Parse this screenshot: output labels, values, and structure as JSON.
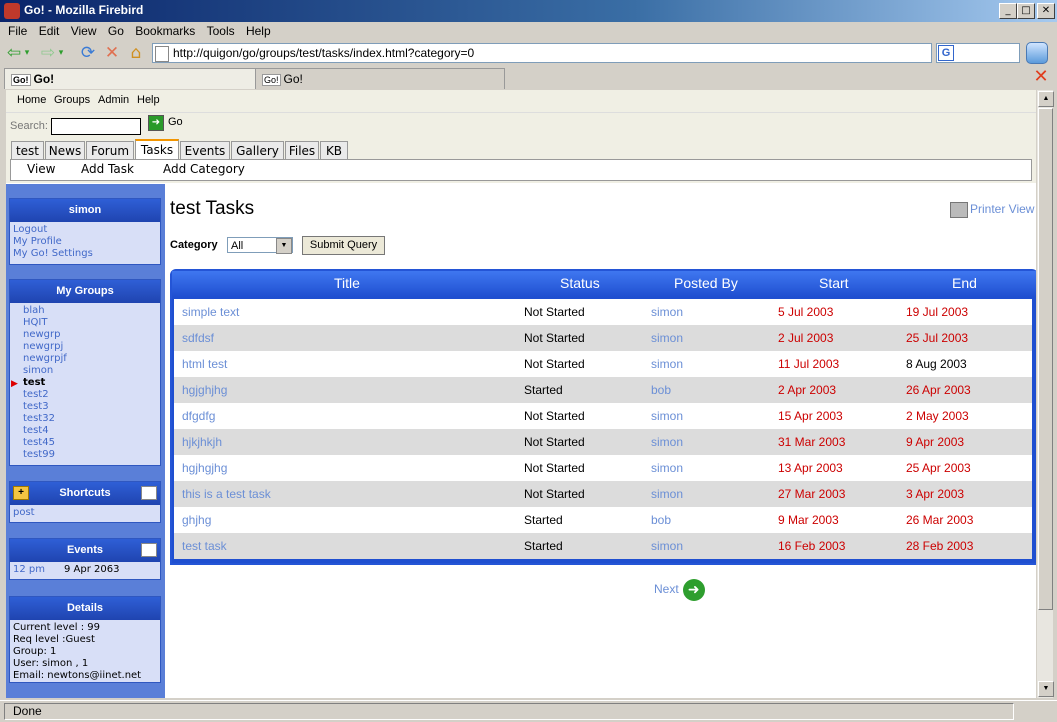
{
  "window": {
    "title": "Go! - Mozilla Firebird"
  },
  "menubar": [
    "File",
    "Edit",
    "View",
    "Go",
    "Bookmarks",
    "Tools",
    "Help"
  ],
  "address": {
    "url": "http://quigon/go/groups/test/tasks/index.html?category=0"
  },
  "browser_tabs": [
    {
      "label": "Go!",
      "icon": "Go!"
    },
    {
      "label": "Go!",
      "icon": "Go!"
    }
  ],
  "site_menu": [
    "Home",
    "Groups",
    "Admin",
    "Help"
  ],
  "search": {
    "label": "Search:",
    "go_label": "Go"
  },
  "site_tabs": [
    "test",
    "News",
    "Forum",
    "Tasks",
    "Events",
    "Gallery",
    "Files",
    "KB"
  ],
  "active_tab": "Tasks",
  "subnav": [
    "View",
    "Add Task",
    "Add Category"
  ],
  "user_box": {
    "title": "simon",
    "links": [
      "Logout",
      "My Profile",
      "My Go! Settings"
    ]
  },
  "groups_box": {
    "title": "My Groups",
    "current": "test",
    "items": [
      "blah",
      "HQIT",
      "newgrp",
      "newgrpj",
      "newgrpjf",
      "simon",
      "test",
      "test2",
      "test3",
      "test32",
      "test4",
      "test45",
      "test99"
    ]
  },
  "shortcuts_box": {
    "title": "Shortcuts",
    "items": [
      "post"
    ]
  },
  "events_box": {
    "title": "Events",
    "time": "12 pm",
    "date": "9 Apr 2063"
  },
  "details_box": {
    "title": "Details",
    "lines": [
      "Current level : 99",
      "Req level :Guest",
      "Group: 1",
      "User: simon , 1",
      "Email: newtons@iinet.net"
    ]
  },
  "page": {
    "title": "test Tasks",
    "printer_view": "Printer View",
    "category_label": "Category",
    "category_value": "All",
    "submit_label": "Submit Query",
    "next_label": "Next"
  },
  "table": {
    "headers": [
      "Title",
      "Status",
      "Posted By",
      "Start",
      "End"
    ],
    "rows": [
      {
        "title": "simple text",
        "status": "Not Started",
        "posted_by": "simon",
        "start": "5 Jul 2003",
        "end": "19 Jul 2003",
        "end_overdue": true
      },
      {
        "title": "sdfdsf",
        "status": "Not Started",
        "posted_by": "simon",
        "start": "2 Jul 2003",
        "end": "25 Jul 2003",
        "end_overdue": true
      },
      {
        "title": "html test",
        "status": "Not Started",
        "posted_by": "simon",
        "start": "11 Jul 2003",
        "end": "8 Aug 2003",
        "end_overdue": false
      },
      {
        "title": "hgjghjhg",
        "status": "Started",
        "posted_by": "bob",
        "start": "2 Apr 2003",
        "end": "26 Apr 2003",
        "end_overdue": true
      },
      {
        "title": "dfgdfg",
        "status": "Not Started",
        "posted_by": "simon",
        "start": "15 Apr 2003",
        "end": "2 May 2003",
        "end_overdue": true
      },
      {
        "title": "hjkjhkjh",
        "status": "Not Started",
        "posted_by": "simon",
        "start": "31 Mar 2003",
        "end": "9 Apr 2003",
        "end_overdue": true
      },
      {
        "title": "hgjhgjhg",
        "status": "Not Started",
        "posted_by": "simon",
        "start": "13 Apr 2003",
        "end": "25 Apr 2003",
        "end_overdue": true
      },
      {
        "title": "this is a test task",
        "status": "Not Started",
        "posted_by": "simon",
        "start": "27 Mar 2003",
        "end": "3 Apr 2003",
        "end_overdue": true
      },
      {
        "title": "ghjhg",
        "status": "Started",
        "posted_by": "bob",
        "start": "9 Mar 2003",
        "end": "26 Mar 2003",
        "end_overdue": true
      },
      {
        "title": "test task",
        "status": "Started",
        "posted_by": "simon",
        "start": "16 Feb 2003",
        "end": "28 Feb 2003",
        "end_overdue": true
      }
    ]
  },
  "status_bar": "Done",
  "colors": {
    "accent": "#2455d6",
    "link": "#6b8fd6",
    "overdue": "#cc0000"
  }
}
